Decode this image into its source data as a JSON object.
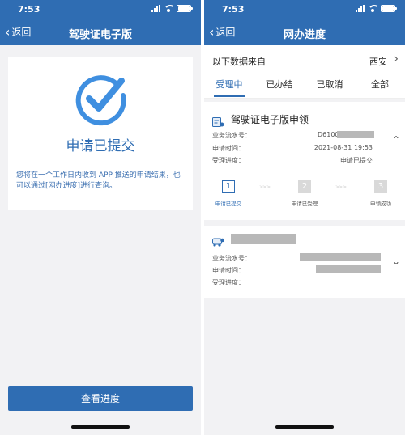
{
  "status_bar": {
    "time": "7:53"
  },
  "left_screen": {
    "nav": {
      "back_label": "返回",
      "title": "驾驶证电子版"
    },
    "success": {
      "title": "申请已提交",
      "description": "您将在一个工作日内收到 APP 推送的申请结果，也可以通过[网办进度]进行查询。"
    },
    "primary_button": "查看进度"
  },
  "right_screen": {
    "nav": {
      "back_label": "返回",
      "title": "网办进度"
    },
    "source": {
      "label": "以下数据来自",
      "city": "西安"
    },
    "tabs": [
      {
        "label": "受理中",
        "active": true
      },
      {
        "label": "已办结",
        "active": false
      },
      {
        "label": "已取消",
        "active": false
      },
      {
        "label": "全部",
        "active": false
      }
    ],
    "card1": {
      "title": "驾驶证电子版申领",
      "fields": {
        "serial_label": "业务流水号：",
        "serial_value": "D6100",
        "time_label": "申请时间：",
        "time_value": "2021-08-31 19:53",
        "progress_label": "受理进度：",
        "progress_value": "申请已提交"
      },
      "steps": [
        {
          "num": "1",
          "label": "申请已提交",
          "active": true
        },
        {
          "num": "2",
          "label": "申请已受理",
          "active": false
        },
        {
          "num": "3",
          "label": "申领成功",
          "active": false
        }
      ],
      "step_arrow": ">> >"
    },
    "card2": {
      "fields": {
        "serial_label": "业务流水号：",
        "time_label": "申请时间：",
        "progress_label": "受理进度："
      }
    },
    "icons": {
      "expand_up": "chevron-up-icon",
      "expand_down": "chevron-down-icon"
    }
  },
  "colors": {
    "brand_blue": "#2f6db3",
    "page_bg": "#f2f2f4",
    "redaction": "#b8b8b8"
  }
}
